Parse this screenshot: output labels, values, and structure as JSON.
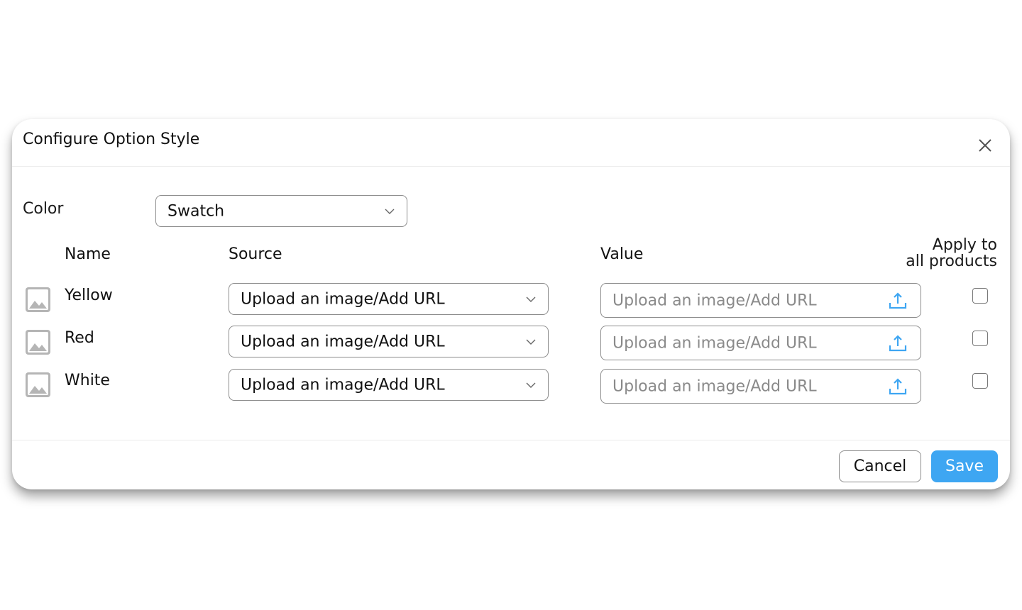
{
  "dialog": {
    "title": "Configure Option Style",
    "close_icon": "close-icon"
  },
  "option": {
    "label": "Color",
    "style_select_value": "Swatch"
  },
  "columns": {
    "name": "Name",
    "source": "Source",
    "value": "Value",
    "apply_line1": "Apply to",
    "apply_line2": "all products"
  },
  "rows": [
    {
      "name": "Yellow",
      "source": "Upload an image/Add URL",
      "value_placeholder": "Upload an image/Add URL",
      "apply_checked": false
    },
    {
      "name": "Red",
      "source": "Upload an image/Add URL",
      "value_placeholder": "Upload an image/Add URL",
      "apply_checked": false
    },
    {
      "name": "White",
      "source": "Upload an image/Add URL",
      "value_placeholder": "Upload an image/Add URL",
      "apply_checked": false
    }
  ],
  "footer": {
    "cancel_label": "Cancel",
    "save_label": "Save"
  },
  "colors": {
    "accent": "#3ea6f2",
    "border": "#8c8c8c",
    "placeholder": "#8a8a8a",
    "image_icon": "#b5b5b5"
  },
  "icons": {
    "row_thumbnail": "image-placeholder-icon",
    "dropdown": "chevron-down-icon",
    "upload": "upload-icon"
  }
}
